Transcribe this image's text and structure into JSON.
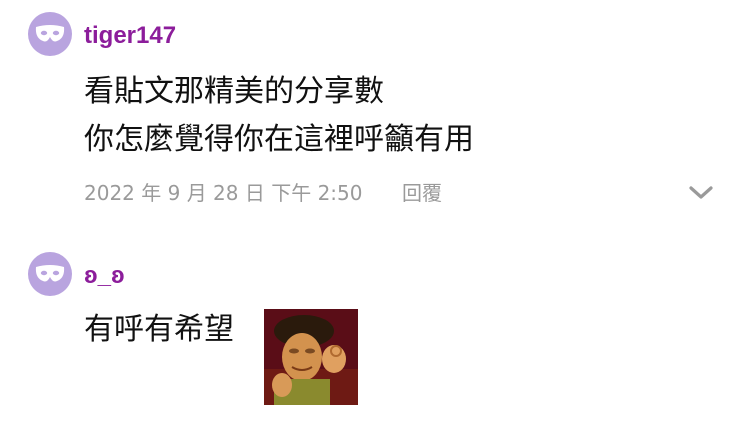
{
  "colors": {
    "username": "#8c1d9b",
    "avatar_bg": "#b9a4df",
    "meta_text": "#9a9a9a",
    "body_text": "#111111"
  },
  "comments": [
    {
      "username": "tiger147",
      "avatar_icon": "mask-icon",
      "lines": [
        "看貼文那精美的分享數",
        "你怎麼覺得你在這裡呼籲有用"
      ],
      "timestamp": "2022 年 9 月 28 日 下午 2:50",
      "reply_label": "回覆",
      "expand_icon": "chevron-down-icon"
    },
    {
      "username": "ʚ_ʚ",
      "avatar_icon": "mask-icon",
      "lines": [
        "有呼有希望"
      ],
      "sticker": "sticker-image"
    }
  ]
}
